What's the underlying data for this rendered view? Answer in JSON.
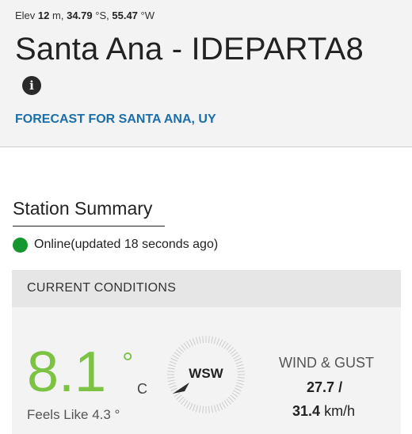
{
  "header": {
    "elev_prefix": "Elev",
    "elev_value": "12",
    "elev_unit": "m,",
    "lat_value": "34.79",
    "lat_unit": "°S,",
    "lon_value": "55.47",
    "lon_unit": "°W",
    "station_title": "Santa Ana - IDEPARTA8",
    "info_icon": "info-circle-icon",
    "forecast_link": "FORECAST FOR SANTA ANA, UY"
  },
  "summary": {
    "title": "Station Summary",
    "status_text": "Online(updated 18 seconds ago)",
    "status_color": "#159630"
  },
  "current": {
    "header": "CURRENT CONDITIONS",
    "temperature": "8.1",
    "degree_symbol": "°",
    "temp_unit": "C",
    "feels_like": "Feels Like 4.3 °",
    "temp_color": "#7cc243",
    "wind_direction": "WSW",
    "wind_label": "WIND & GUST",
    "wind_speed": "27.7",
    "wind_separator": "/",
    "wind_gust": "31.4",
    "wind_unit": "km/h"
  },
  "colors": {
    "link": "#1b6ea8",
    "header_bg": "#f3f3f3"
  }
}
